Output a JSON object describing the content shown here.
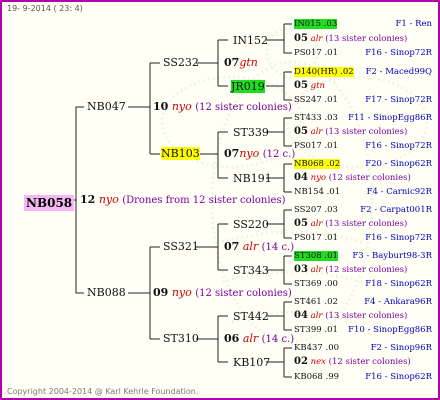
{
  "header": {
    "date": "19-  9-2014 ( 23: 4)"
  },
  "footer": {
    "copyright": "Copyright 2004-2014 @ Karl Kehrle Foundation."
  },
  "root": {
    "name": "NB058",
    "gen": "12",
    "code": "nyo",
    "note": "(Drones from 12 sister colonies)",
    "color": "#f4b8f4"
  },
  "colors": {
    "green": "#20dd20",
    "yellow": "#ffff00",
    "border": "#b000b0",
    "code": "#cc0000",
    "sister": "#7a00a0",
    "right": "#0000c0"
  },
  "gen1": [
    {
      "name": "NB047",
      "gen": "10",
      "code": "nyo",
      "note": "(12 sister colonies)"
    },
    {
      "name": "NB088",
      "gen": "09",
      "code": "nyo",
      "note": "(12 sister colonies)"
    }
  ],
  "gen2": [
    {
      "name": "SS232",
      "gen": "07",
      "code": "gtn",
      "note": ""
    },
    {
      "name": "NB103",
      "gen": "07",
      "code": "nyo",
      "note": "(12 c.)"
    },
    {
      "name": "SS321",
      "gen": "07",
      "code": "alr",
      "note": "(14 c.)"
    },
    {
      "name": "ST310",
      "gen": "06",
      "code": "alr",
      "note": "(14 c.)"
    }
  ],
  "gen3": [
    {
      "name": "IN152",
      "gen": "05",
      "code": "alr",
      "note": "(13 sister colonies)"
    },
    {
      "name": "JR019",
      "gen": "05",
      "code": "gtn",
      "note": ""
    },
    {
      "name": "ST339",
      "gen": "05",
      "code": "alr",
      "note": "(13 sister colonies)"
    },
    {
      "name": "NB191",
      "gen": "04",
      "code": "nyo",
      "note": "(12 sister colonies)"
    },
    {
      "name": "SS220",
      "gen": "05",
      "code": "alr",
      "note": "(13 sister colonies)"
    },
    {
      "name": "ST343",
      "gen": "03",
      "code": "alr",
      "note": "(12 sister colonies)"
    },
    {
      "name": "ST442",
      "gen": "04",
      "code": "alr",
      "note": "(13 sister colonies)"
    },
    {
      "name": "KB107",
      "gen": "02",
      "code": "nex",
      "note": "(12 sister colonies)"
    }
  ],
  "gen4": [
    {
      "left": "IN015 .03",
      "right": "F1 - Ren"
    },
    {
      "left": "PS017 .01",
      "right": "F16 - Sinop72R"
    },
    {
      "left": "D140(HR) .02",
      "right": "F2 - Maced99Q"
    },
    {
      "left": "SS247 .01",
      "right": "F17 - Sinop72R"
    },
    {
      "left": "ST433 .03",
      "right": "F11 - SinopEgg86R"
    },
    {
      "left": "PS017 .01",
      "right": "F16 - Sinop72R"
    },
    {
      "left": "NB068 .02",
      "right": "F20 - Sinop62R"
    },
    {
      "left": "NB154 .01",
      "right": "F4 - Carnic92R"
    },
    {
      "left": "SS207 .03",
      "right": "F2 - Carpat001R"
    },
    {
      "left": "PS017 .01",
      "right": "F16 - Sinop72R"
    },
    {
      "left": "ST308 .01",
      "right": "F3 - Bayburt98-3R"
    },
    {
      "left": "ST369 .00",
      "right": "F18 - Sinop62R"
    },
    {
      "left": "ST461 .02",
      "right": "F4 - Ankara96R"
    },
    {
      "left": "ST399 .01",
      "right": "F10 - SinopEgg86R"
    },
    {
      "left": "KB437 .00",
      "right": "F2 - Sinop96R"
    },
    {
      "left": "KB068 .99",
      "right": "F16 - Sinop62R"
    }
  ]
}
